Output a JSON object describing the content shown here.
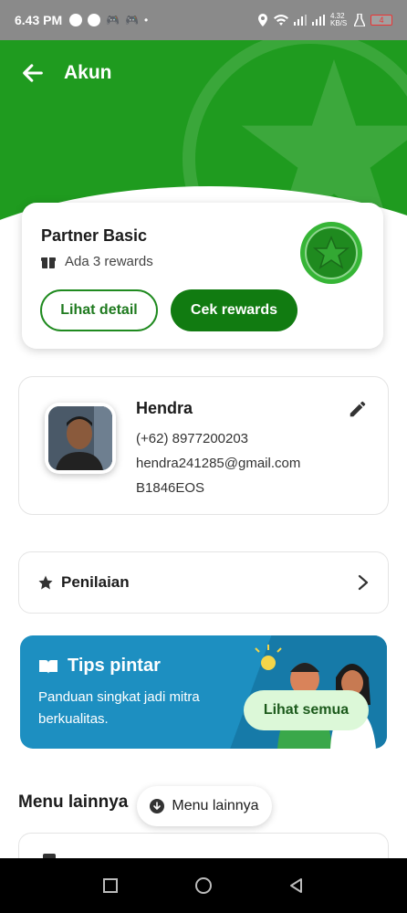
{
  "status_bar": {
    "time": "6.43 PM",
    "network": "4.32 KB/S",
    "battery": "4"
  },
  "header": {
    "title": "Akun"
  },
  "partner_card": {
    "title": "Partner Basic",
    "rewards_text": "Ada 3 rewards",
    "detail_button": "Lihat detail",
    "rewards_button": "Cek rewards"
  },
  "profile": {
    "name": "Hendra",
    "phone": "(+62) 8977200203",
    "email": "hendra241285@gmail.com",
    "plate": "B1846EOS"
  },
  "rating": {
    "label": "Penilaian"
  },
  "tips": {
    "title": "Tips pintar",
    "description": "Panduan singkat jadi mitra berkualitas.",
    "button": "Lihat semua"
  },
  "menu": {
    "title": "Menu lainnya",
    "pill_label": "Menu lainnya"
  },
  "colors": {
    "primary_green": "#1f9b1f",
    "dark_green": "#117b11",
    "tips_blue": "#1d8fc1"
  }
}
